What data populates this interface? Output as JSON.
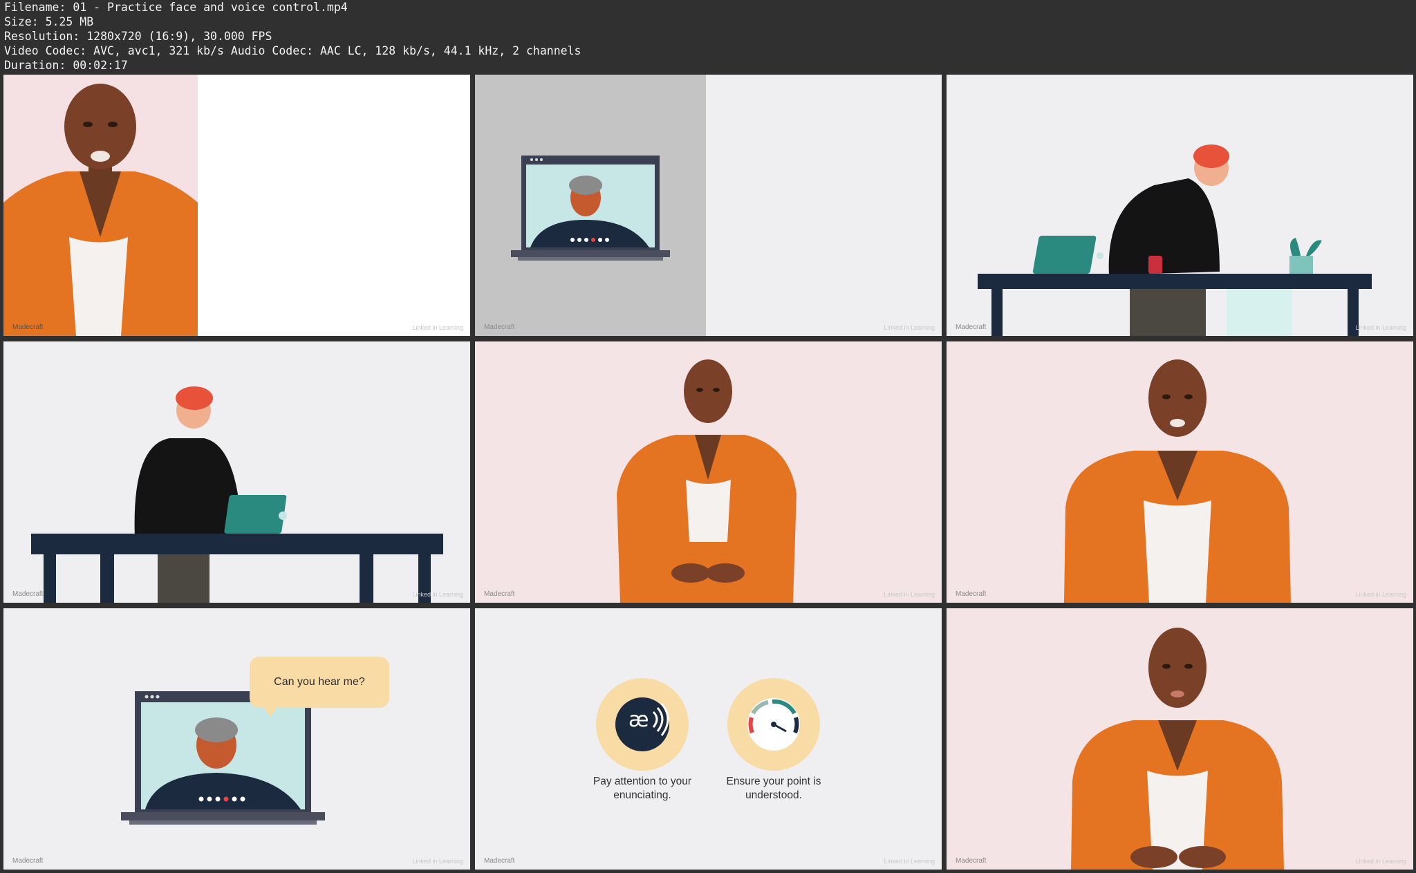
{
  "info": {
    "filename": "Filename: 01 - Practice face and voice control.mp4",
    "size": "Size: 5.25 MB",
    "resolution": "Resolution: 1280x720 (16:9), 30.000 FPS",
    "codec": "Video Codec: AVC, avc1, 321 kb/s Audio Codec: AAC LC, 128 kb/s, 44.1 kHz, 2 channels",
    "duration": "Duration: 00:02:17"
  },
  "watermarks": {
    "left": "Madecraft",
    "right": "Linked in Learning"
  },
  "frames": {
    "bubble_text": "Can you hear me?",
    "caption_1": "Pay attention to your enunciating.",
    "caption_2": "Ensure your point is understood.",
    "icon_1": "æ"
  },
  "colors": {
    "background": "#303030",
    "orange": "#e57323",
    "navy": "#1b2a3f",
    "teal": "#2a8a7f",
    "pink": "#f5e4e6",
    "badge": "#f9dca5"
  },
  "icons": [
    "enunciation-icon",
    "speedometer-icon",
    "laptop-icon",
    "video-call-icon"
  ]
}
